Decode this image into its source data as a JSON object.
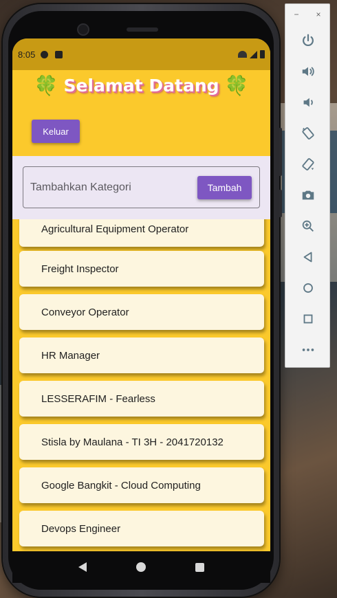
{
  "status_bar": {
    "time": "8:05"
  },
  "header": {
    "clover_left": "🍀",
    "title": "Selamat Datang",
    "clover_right": "🍀",
    "logout_label": "Keluar"
  },
  "input": {
    "placeholder": "Tambahkan Kategori",
    "add_label": "Tambah"
  },
  "categories": [
    "Agricultural Equipment Operator",
    "Freight Inspector",
    "Conveyor Operator",
    "HR Manager",
    "LESSERAFIM - Fearless",
    "Stisla by Maulana - TI 3H - 2041720132",
    "Google Bangkit - Cloud Computing",
    "Devops Engineer"
  ],
  "emulator_toolbar": {
    "minimize": "−",
    "close": "×",
    "buttons": [
      "power-icon",
      "volume-up-icon",
      "volume-down-icon",
      "rotate-left-icon",
      "rotate-right-icon",
      "camera-icon",
      "zoom-icon",
      "back-icon",
      "home-icon",
      "overview-icon",
      "more-icon"
    ]
  },
  "colors": {
    "app_bar": "#fbc92c",
    "status_bar": "#c89a14",
    "button": "#7e57c2",
    "input_area": "#ece6f3",
    "card": "#fdf6df"
  }
}
